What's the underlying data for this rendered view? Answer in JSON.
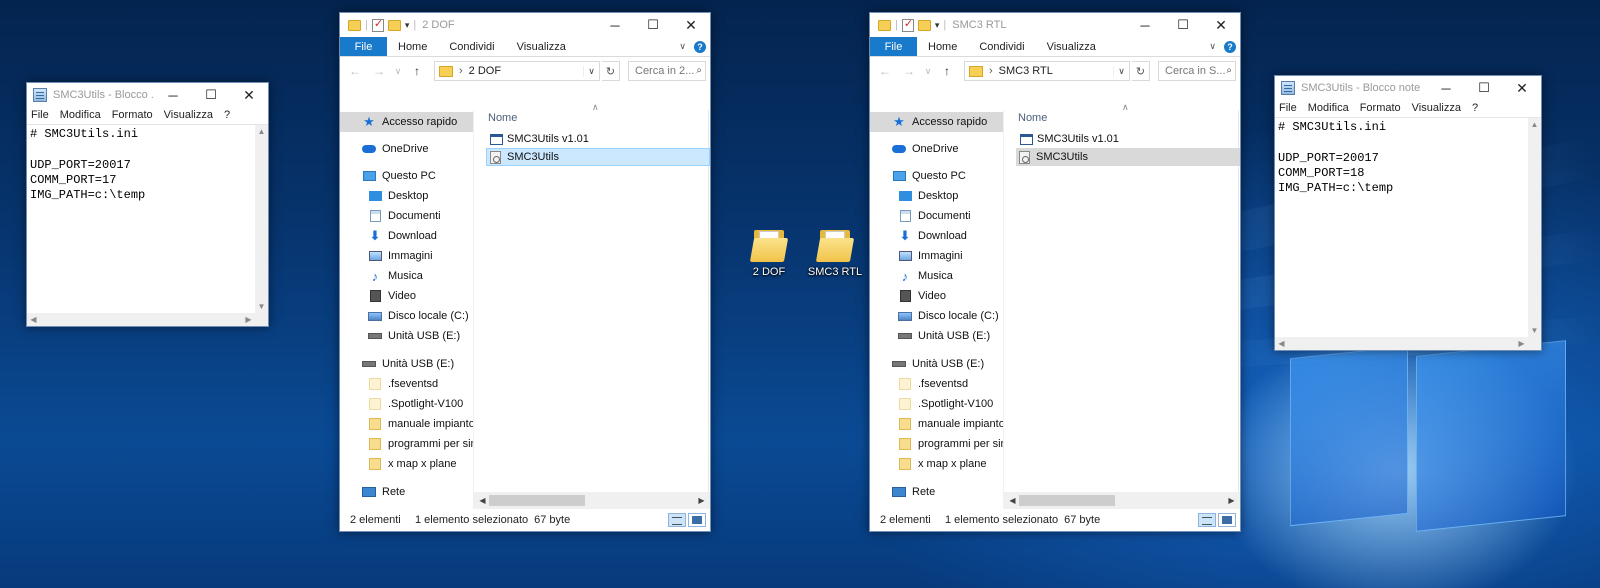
{
  "notepad_left": {
    "title": "SMC3Utils - Blocco ...",
    "menu": [
      "File",
      "Modifica",
      "Formato",
      "Visualizza",
      "?"
    ],
    "lines": [
      "# SMC3Utils.ini",
      "",
      "UDP_PORT=20017",
      "COMM_PORT=17",
      "IMG_PATH=c:\\temp"
    ]
  },
  "notepad_right": {
    "title": "SMC3Utils - Blocco note",
    "menu": [
      "File",
      "Modifica",
      "Formato",
      "Visualizza",
      "?"
    ],
    "lines": [
      "# SMC3Utils.ini",
      "",
      "UDP_PORT=20017",
      "COMM_PORT=18",
      "IMG_PATH=c:\\temp"
    ]
  },
  "explorer_left": {
    "title": "2 DOF",
    "tabs": [
      "File",
      "Home",
      "Condividi",
      "Visualizza"
    ],
    "address": "2 DOF",
    "search_placeholder": "Cerca in 2...",
    "column_name": "Nome",
    "nav": [
      "Accesso rapido",
      "OneDrive",
      "Questo PC",
      "Desktop",
      "Documenti",
      "Download",
      "Immagini",
      "Musica",
      "Video",
      "Disco locale (C:)",
      "Unità USB (E:)",
      "Unità USB (E:)",
      ".fseventsd",
      ".Spotlight-V100",
      "manuale impianto s",
      "programmi per simu",
      "x map x plane",
      "Rete"
    ],
    "files": [
      "SMC3Utils v1.01",
      "SMC3Utils"
    ],
    "status_count": "2 elementi",
    "status_selection": "1 elemento selezionato",
    "status_size": "67 byte"
  },
  "explorer_right": {
    "title": "SMC3 RTL",
    "tabs": [
      "File",
      "Home",
      "Condividi",
      "Visualizza"
    ],
    "address": "SMC3 RTL",
    "search_placeholder": "Cerca in S...",
    "column_name": "Nome",
    "nav": [
      "Accesso rapido",
      "OneDrive",
      "Questo PC",
      "Desktop",
      "Documenti",
      "Download",
      "Immagini",
      "Musica",
      "Video",
      "Disco locale (C:)",
      "Unità USB (E:)",
      "Unità USB (E:)",
      ".fseventsd",
      ".Spotlight-V100",
      "manuale impianto s",
      "programmi per simu",
      "x map x plane",
      "Rete"
    ],
    "files": [
      "SMC3Utils v1.01",
      "SMC3Utils"
    ],
    "status_count": "2 elementi",
    "status_selection": "1 elemento selezionato",
    "status_size": "67 byte"
  },
  "desktop_icons": [
    "2 DOF",
    "SMC3 RTL"
  ],
  "colors": {
    "accent": "#1979ca",
    "selection": "#cce8ff",
    "desktop": "#0a4a94"
  }
}
